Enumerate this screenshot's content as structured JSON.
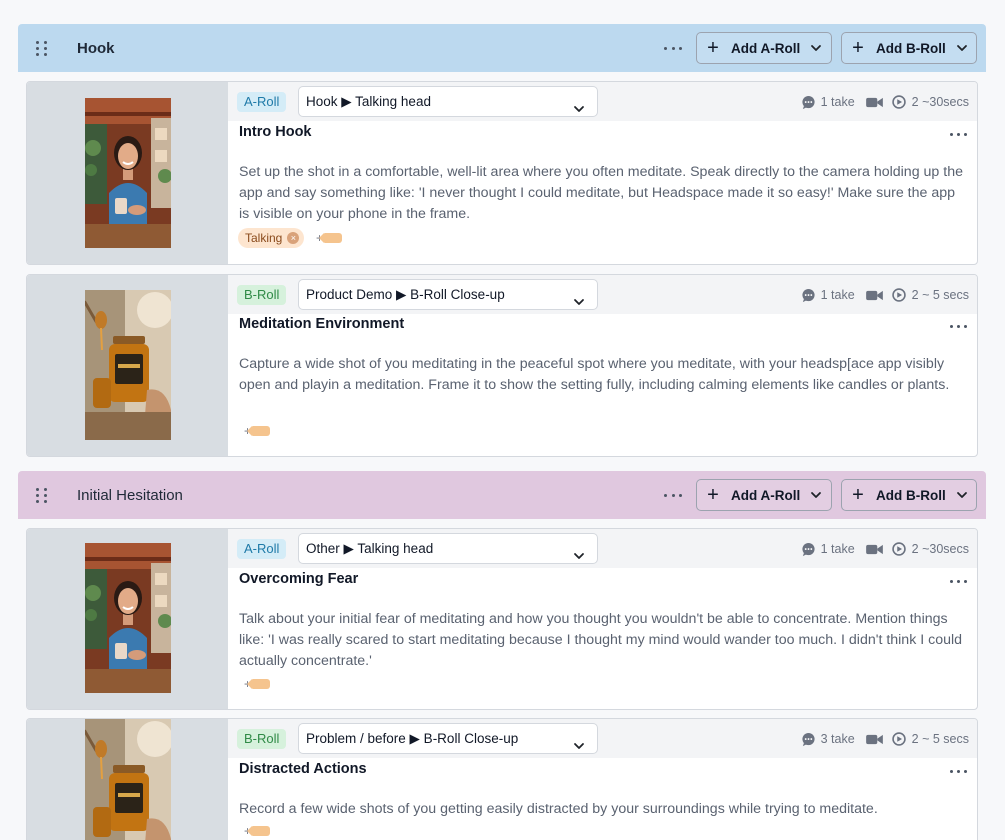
{
  "colors": {
    "hook_header_bg": "#bcd9ef",
    "hesitation_header_bg": "#e0c8df",
    "a_roll_badge_bg": "#d4ecf7",
    "b_roll_badge_bg": "#d6f1dc",
    "tag_bg": "#fde5cf"
  },
  "labels": {
    "add_a_roll": "Add A-Roll",
    "add_b_roll": "Add B-Roll",
    "add_tag": "+"
  },
  "sections": [
    {
      "title": "Hook",
      "scenes": [
        {
          "roll": "A-Roll",
          "type": "Hook ▶ Talking head",
          "takes": "1",
          "take_unit": "take",
          "duration_count": "2",
          "duration": "~30secs",
          "title": "Intro Hook",
          "description": "Set up the shot in a comfortable, well-lit area where you often meditate. Speak directly to the camera holding up the app and say something like: 'I never thought I could meditate, but Headspace made it so easy!' Make sure the app is visible on your phone in the frame.",
          "tags": [
            "Talking"
          ],
          "thumbnail": "woman-holding-cup"
        },
        {
          "roll": "B-Roll",
          "type": "Product Demo ▶ B-Roll Close-up",
          "takes": "1",
          "take_unit": "take",
          "duration_count": "2",
          "duration": "~ 5 secs",
          "title": "Meditation Environment",
          "description": "Capture a wide shot of you meditating in the peaceful spot where you meditate, with your headsp[ace app visibly open and playin a meditation. Frame it to show the setting fully, including calming elements like candles or plants.",
          "tags": [],
          "thumbnail": "honey-jar"
        }
      ]
    },
    {
      "title": "Initial Hesitation",
      "scenes": [
        {
          "roll": "A-Roll",
          "type": "Other ▶ Talking head",
          "takes": "1",
          "take_unit": "take",
          "duration_count": "2",
          "duration": "~30secs",
          "title": "Overcoming Fear",
          "description": "Talk about your initial fear of meditating and how you thought you wouldn't be able to concentrate. Mention things like: 'I was really scared to start meditating because I thought my mind would wander too much. I didn't think I could actually concentrate.'",
          "tags": [],
          "thumbnail": "woman-holding-cup"
        },
        {
          "roll": "B-Roll",
          "type": "Problem / before ▶ B-Roll Close-up",
          "takes": "3",
          "take_unit": "take",
          "duration_count": "2",
          "duration": "~ 5 secs",
          "title": "Distracted Actions",
          "description": "Record a few wide shots of you getting easily distracted by your surroundings while trying to meditate.",
          "tags": [],
          "thumbnail": "honey-jar"
        }
      ]
    }
  ]
}
